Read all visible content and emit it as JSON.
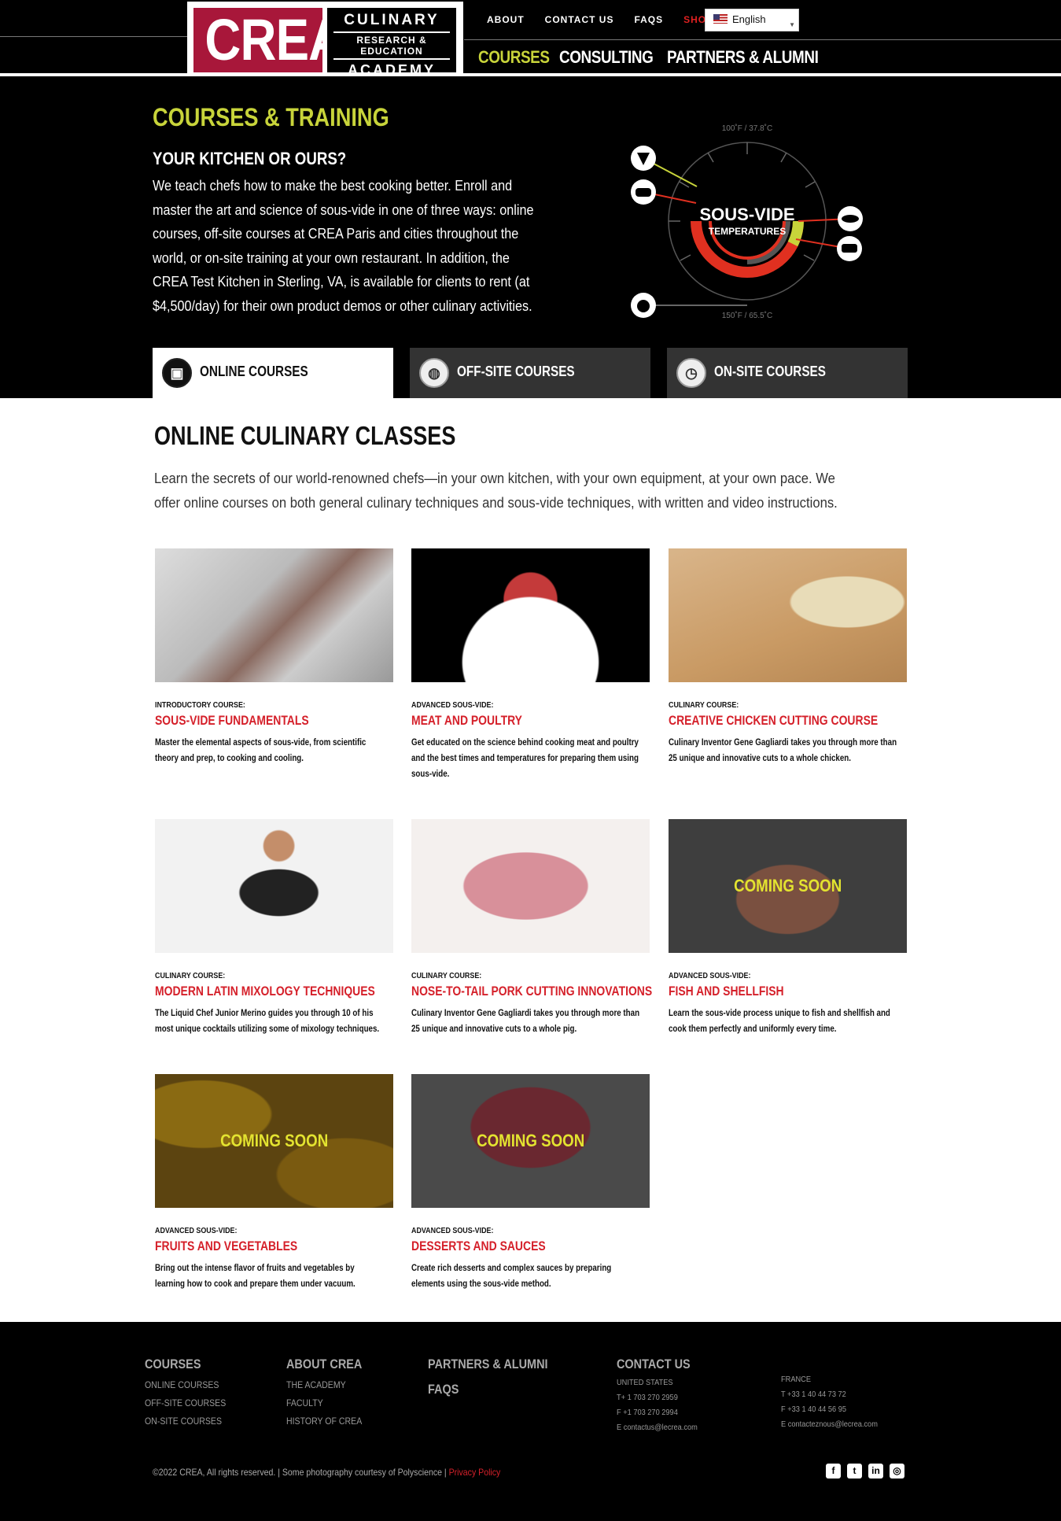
{
  "header": {
    "logo_main": "CREA",
    "logo_line1": "CULINARY",
    "logo_line2": "RESEARCH & EDUCATION",
    "logo_line3": "ACADEMY",
    "top_links": [
      "ABOUT",
      "CONTACT US",
      "FAQS",
      "SHOP"
    ],
    "language": "English",
    "main_nav": [
      "COURSES",
      "CONSULTING",
      "PARTNERS & ALUMNI"
    ]
  },
  "hero": {
    "title": "COURSES & TRAINING",
    "subtitle": "YOUR KITCHEN OR OURS?",
    "body": "We teach chefs how to make the best cooking better. Enroll and master the art and science of sous-vide in one of three ways: online courses, off-site courses at CREA Paris and cities throughout the world, or on-site training at your own restaurant. In addition, the CREA Test Kitchen in Sterling, VA, is available for clients to rent (at $4,500/day) for their own product demos or other culinary activities.",
    "dial": {
      "title": "SOUS-VIDE",
      "subtitle": "TEMPERATURES",
      "top_label": "100˚F / 37.8˚C",
      "bottom_label": "150˚F / 65.5˚C",
      "accent": "#c8d43a",
      "red": "#e03020"
    }
  },
  "tabs": [
    {
      "label": "ONLINE COURSES",
      "icon": "laptop-icon"
    },
    {
      "label": "OFF-SITE COURSES",
      "icon": "globe-icon"
    },
    {
      "label": "ON-SITE COURSES",
      "icon": "clock-icon"
    }
  ],
  "main": {
    "heading": "ONLINE CULINARY CLASSES",
    "intro": "Learn the secrets of our world-renowned chefs—in your own kitchen, with your own equipment, at your own pace. We offer online courses on both general culinary techniques and sous-vide techniques, with written and video instructions."
  },
  "cards": [
    {
      "category": "INTRODUCTORY COURSE:",
      "title": "SOUS-VIDE FUNDAMENTALS",
      "desc": "Master the elemental aspects of sous-vide, from scientific theory and prep, to cooking and cooling.",
      "soon": ""
    },
    {
      "category": "ADVANCED SOUS-VIDE:",
      "title": "MEAT AND POULTRY",
      "desc": "Get educated on the science behind cooking meat and poultry and the best times and temperatures for preparing them using sous-vide.",
      "soon": ""
    },
    {
      "category": "CULINARY COURSE:",
      "title": "CREATIVE CHICKEN CUTTING COURSE",
      "desc": "Culinary Inventor Gene Gagliardi takes you through more than 25 unique and innovative cuts to a whole chicken.",
      "soon": ""
    },
    {
      "category": "CULINARY COURSE:",
      "title": "MODERN LATIN MIXOLOGY TECHNIQUES",
      "desc": "The Liquid Chef Junior Merino guides you through 10 of his most unique cocktails utilizing some of mixology techniques.",
      "soon": ""
    },
    {
      "category": "CULINARY COURSE:",
      "title": "NOSE-TO-TAIL PORK CUTTING INNOVATIONS",
      "desc": "Culinary Inventor Gene Gagliardi takes you through more than 25 unique and innovative cuts to a whole pig.",
      "soon": ""
    },
    {
      "category": "ADVANCED SOUS-VIDE:",
      "title": "FISH AND SHELLFISH",
      "desc": "Learn the sous-vide process unique to fish and shellfish and cook them perfectly and uniformly every time.",
      "soon": "COMING SOON"
    },
    {
      "category": "ADVANCED SOUS-VIDE:",
      "title": "FRUITS AND VEGETABLES",
      "desc": "Bring out the intense flavor of fruits and vegetables by learning how to cook and prepare them under vacuum.",
      "soon": "COMING SOON"
    },
    {
      "category": "ADVANCED SOUS-VIDE:",
      "title": "DESSERTS AND SAUCES",
      "desc": "Create rich desserts and complex sauces by preparing elements using the sous-vide method.",
      "soon": "COMING SOON"
    }
  ],
  "footer": {
    "courses": {
      "heading": "COURSES",
      "items": [
        "ONLINE COURSES",
        "OFF-SITE COURSES",
        "ON-SITE COURSES"
      ]
    },
    "about": {
      "heading": "ABOUT CREA",
      "items": [
        "THE ACADEMY",
        "FACULTY",
        "HISTORY OF CREA"
      ]
    },
    "partners": {
      "heading": "PARTNERS & ALUMNI",
      "faqs": "FAQS"
    },
    "contact": {
      "heading": "CONTACT US",
      "us": [
        "UNITED STATES",
        "T+ 1 703 270 2959",
        "F +1 703 270 2994",
        "E contactus@lecrea.com"
      ],
      "fr": [
        "FRANCE",
        "T +33 1 40 44 73 72",
        "F +33 1 40 44 56 95",
        "E contacteznous@lecrea.com"
      ]
    },
    "copyright": "©2022 CREA, All rights reserved. | Some photography courtesy of Polyscience | ",
    "privacy": "Privacy Policy"
  }
}
